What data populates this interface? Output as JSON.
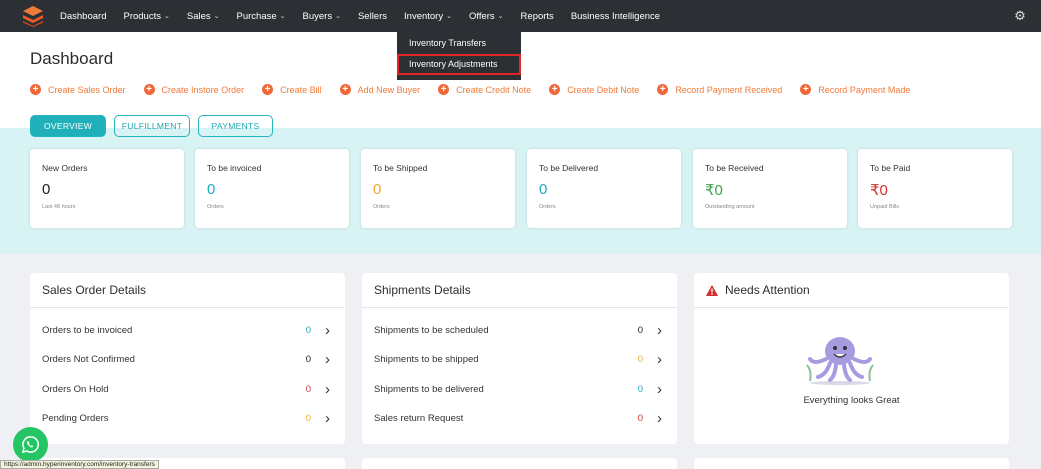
{
  "nav": {
    "items": [
      {
        "label": "Dashboard",
        "has_menu": false
      },
      {
        "label": "Products",
        "has_menu": true
      },
      {
        "label": "Sales",
        "has_menu": true
      },
      {
        "label": "Purchase",
        "has_menu": true
      },
      {
        "label": "Buyers",
        "has_menu": true
      },
      {
        "label": "Sellers",
        "has_menu": false
      },
      {
        "label": "Inventory",
        "has_menu": true
      },
      {
        "label": "Offers",
        "has_menu": true
      },
      {
        "label": "Reports",
        "has_menu": false
      },
      {
        "label": "Business Intelligence",
        "has_menu": false
      }
    ],
    "chevron_icon": "chevron-down-icon",
    "settings_icon": "gear-icon",
    "background": "#2c2f33"
  },
  "inventory_menu": {
    "items": [
      "Inventory Transfers",
      "Inventory Adjustments"
    ],
    "highlight_color": "#e0262a"
  },
  "page": {
    "title": "Dashboard"
  },
  "quick_actions": {
    "items": [
      "Create Sales Order",
      "Create Instore Order",
      "Create Bill",
      "Add New Buyer",
      "Create Credit Note",
      "Create Debit Note",
      "Record Payment Received",
      "Record Payment Made"
    ],
    "color": "#f07a3a"
  },
  "tabs": {
    "items": [
      "OVERVIEW",
      "FULFILLMENT",
      "PAYMENTS"
    ],
    "active": "OVERVIEW",
    "accent": "#1fb0ba"
  },
  "stats": [
    {
      "label": "New Orders",
      "value": "0",
      "sub": "Last 48 hours",
      "color": "#222222"
    },
    {
      "label": "To be invoiced",
      "value": "0",
      "sub": "Orders",
      "color": "#1ea7c4"
    },
    {
      "label": "To be Shipped",
      "value": "0",
      "sub": "Orders",
      "color": "#f0a830"
    },
    {
      "label": "To be Delivered",
      "value": "0",
      "sub": "Orders",
      "color": "#1ea7c4"
    },
    {
      "label": "To be Received",
      "value": "₹0",
      "sub": "Outstanding amount",
      "color": "#3aa24a"
    },
    {
      "label": "To be Paid",
      "value": "₹0",
      "sub": "Unpaid Bills",
      "color": "#d32f2f"
    }
  ],
  "sales_order_details": {
    "title": "Sales Order Details",
    "rows": [
      {
        "label": "Orders to be invoiced",
        "count": "0",
        "color": "#1ea7c4"
      },
      {
        "label": "Orders Not Confirmed",
        "count": "0",
        "color": "#222222"
      },
      {
        "label": "Orders On Hold",
        "count": "0",
        "color": "#d32f2f"
      },
      {
        "label": "Pending Orders",
        "count": "0",
        "color": "#f0a830"
      }
    ]
  },
  "shipments_details": {
    "title": "Shipments Details",
    "rows": [
      {
        "label": "Shipments to be scheduled",
        "count": "0",
        "color": "#222222"
      },
      {
        "label": "Shipments to be shipped",
        "count": "0",
        "color": "#f0a830"
      },
      {
        "label": "Shipments to be delivered",
        "count": "0",
        "color": "#1ea7c4"
      },
      {
        "label": "Sales return Request",
        "count": "0",
        "color": "#d32f2f"
      }
    ]
  },
  "needs_attention": {
    "title": "Needs Attention",
    "message": "Everything looks Great",
    "icon": "warning-icon",
    "warn_color": "#d32f2f"
  },
  "whatsapp": {
    "icon": "whatsapp-icon",
    "color": "#25c465"
  },
  "status_bar": {
    "url": "https://admin.hyperinventory.com/inventory-transfers"
  }
}
